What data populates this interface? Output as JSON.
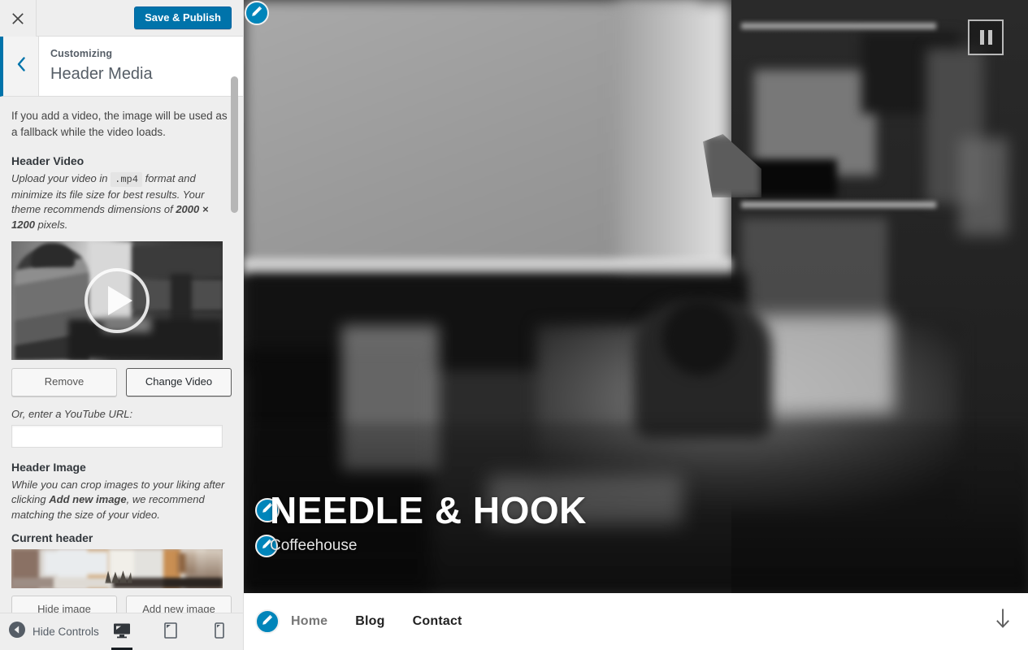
{
  "customizer": {
    "close_icon": "close-x-icon",
    "save_button": "Save & Publish",
    "back_icon": "chevron-left-icon",
    "breadcrumb_label": "Customizing",
    "panel_title": "Header Media",
    "accent_color": "#0073aa",
    "intro_note": "If you add a video, the image will be used as a fallback while the video loads.",
    "header_video": {
      "label": "Header Video",
      "description_part1": "Upload your video in",
      "format_code": ".mp4",
      "description_part2": "format and minimize its file size for best results. Your theme recommends dimensions of",
      "dimensions": "2000 × 1200",
      "description_part3": "pixels.",
      "thumbnail_name": "video-preview-thumbnail",
      "play_icon": "play-icon",
      "remove_button": "Remove",
      "change_button": "Change Video",
      "youtube_label": "Or, enter a YouTube URL:",
      "youtube_value": "",
      "youtube_placeholder": ""
    },
    "header_image": {
      "label": "Header Image",
      "description_part1": "While you can crop images to your liking after clicking",
      "description_bold": "Add new image",
      "description_part2": ", we recommend matching the size of your video.",
      "current_header_label": "Current header",
      "hide_button": "Hide image",
      "add_button": "Add new image"
    },
    "footer": {
      "hide_controls_label": "Hide Controls",
      "collapse_icon": "collapse-arrow-icon",
      "devices": [
        {
          "name": "desktop",
          "icon": "desktop-icon",
          "active": true
        },
        {
          "name": "tablet",
          "icon": "tablet-icon",
          "active": false
        },
        {
          "name": "mobile",
          "icon": "mobile-icon",
          "active": false
        }
      ]
    }
  },
  "preview": {
    "edit_icon": "edit-pencil-icon",
    "pause_button_icon": "pause-icon",
    "site_title": "NEEDLE & HOOK",
    "site_description": "Coffeehouse",
    "nav_items": [
      {
        "label": "Home",
        "active": false
      },
      {
        "label": "Blog",
        "active": true
      },
      {
        "label": "Contact",
        "active": true
      }
    ],
    "scroll_down_icon": "arrow-down-icon"
  }
}
